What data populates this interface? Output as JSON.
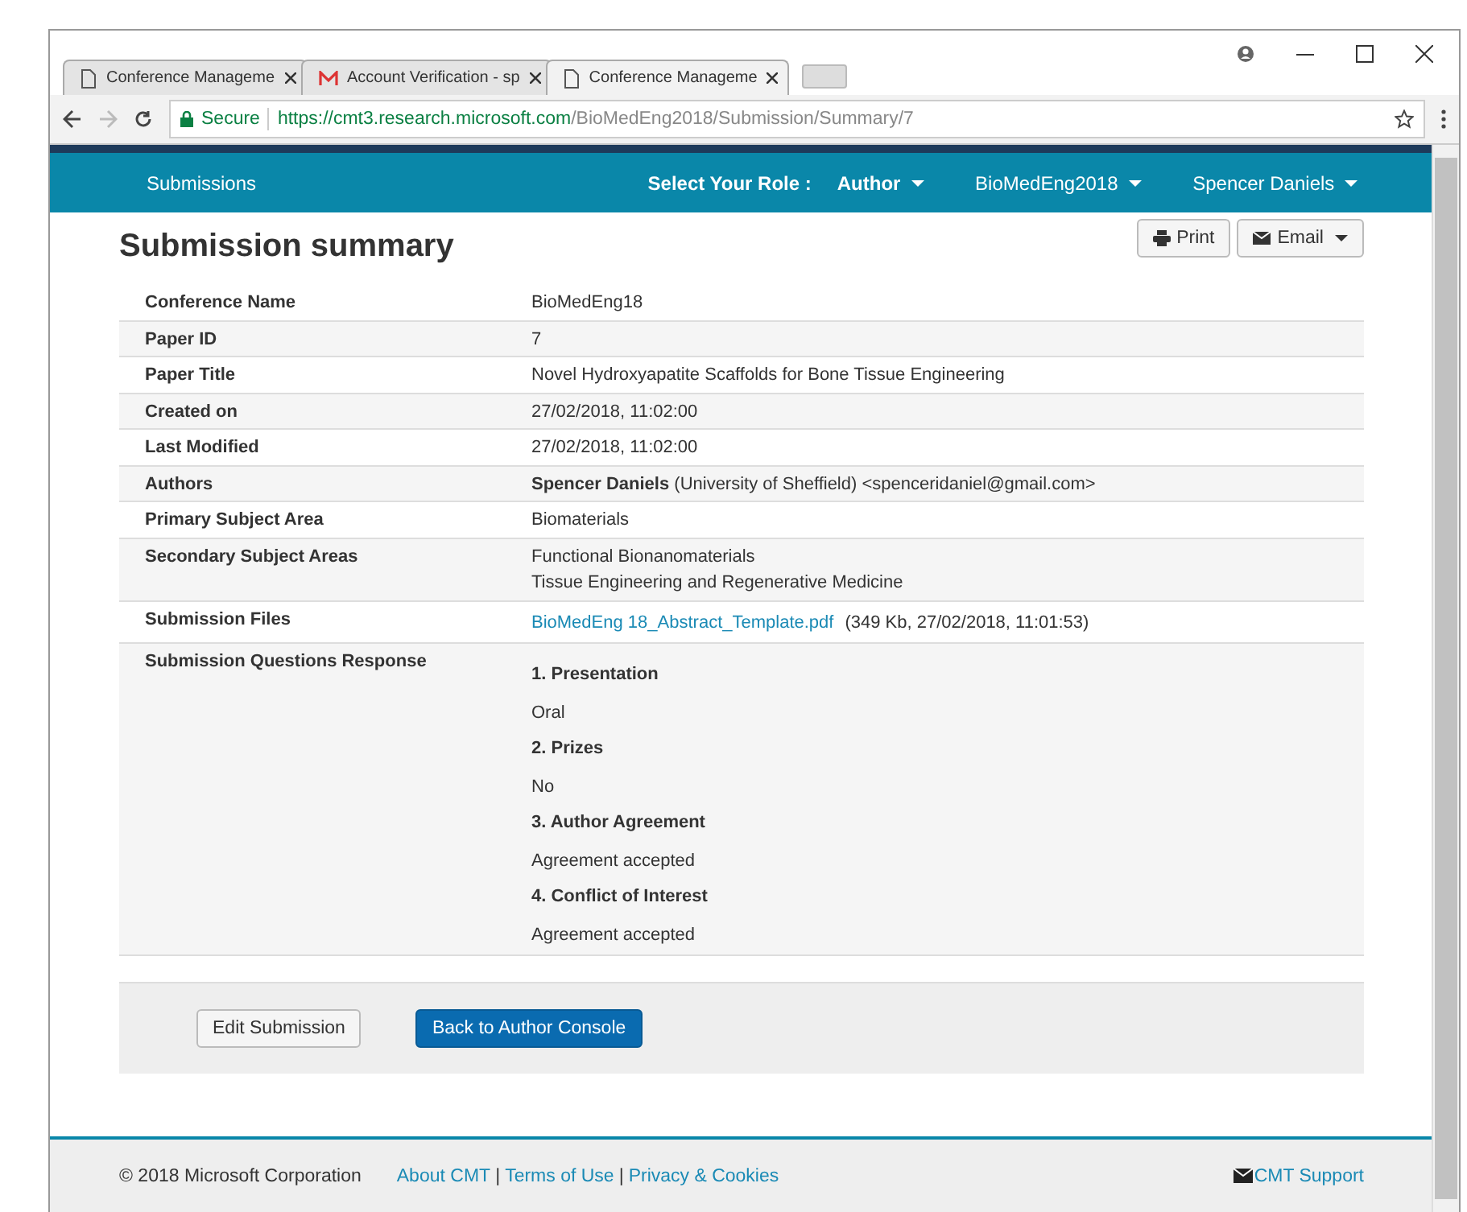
{
  "browser": {
    "tabs": [
      {
        "title": "Conference Manageme",
        "kind": "page",
        "selected": false
      },
      {
        "title": "Account Verification - sp",
        "kind": "mail",
        "selected": false
      },
      {
        "title": "Conference Manageme",
        "kind": "page",
        "selected": true
      }
    ],
    "secure_label": "Secure",
    "url_host": "https://cmt3.research.microsoft.com",
    "url_path": "/BioMedEng2018/Submission/Summary/7"
  },
  "navbar": {
    "left": "Submissions",
    "role_label": "Select Your Role :",
    "menus": [
      {
        "label": "Author",
        "bold": true
      },
      {
        "label": "BioMedEng2018",
        "bold": false
      },
      {
        "label": "Spencer Daniels",
        "bold": false
      }
    ]
  },
  "title": "Submission summary",
  "actions": [
    "Print",
    "Email"
  ],
  "rows": [
    {
      "label": "Conference Name",
      "kind": "text",
      "values": [
        "BioMedEng18"
      ]
    },
    {
      "label": "Paper ID",
      "kind": "text",
      "values": [
        "7"
      ]
    },
    {
      "label": "Paper Title",
      "kind": "text",
      "values": [
        "Novel Hydroxyapatite Scaffolds for Bone Tissue Engineering"
      ]
    },
    {
      "label": "Created on",
      "kind": "text",
      "values": [
        "27/02/2018, 11:02:00"
      ]
    },
    {
      "label": "Last Modified",
      "kind": "text",
      "values": [
        "27/02/2018, 11:02:00"
      ]
    },
    {
      "label": "Authors",
      "kind": "text",
      "values": [
        "**Spencer Daniels** (University of Sheffield) <spenceridaniel@gmail.com>"
      ]
    },
    {
      "label": "Primary Subject Area",
      "kind": "text",
      "values": [
        "Biomaterials"
      ]
    },
    {
      "label": "Secondary Subject Areas",
      "kind": "text",
      "values": [
        "Functional Bionanomaterials",
        "Tissue Engineering and Regenerative Medicine"
      ]
    },
    {
      "label": "Submission Files",
      "kind": "file",
      "link": "BioMedEng 18_Abstract_Template.pdf",
      "values": [
        "(349 Kb, 27/02/2018, 11:01:53)"
      ]
    },
    {
      "label": "Submission Questions Response",
      "kind": "questions",
      "questions": [
        {
          "q": "1. Presentation",
          "a": "Oral"
        },
        {
          "q": "2. Prizes",
          "a": "No"
        },
        {
          "q": "3. Author Agreement",
          "a": "Agreement accepted"
        },
        {
          "q": "4. Conflict of Interest",
          "a": "Agreement accepted"
        }
      ]
    }
  ],
  "buttons": [
    {
      "label": "Edit Submission",
      "primary": false
    },
    {
      "label": "Back to Author Console",
      "primary": true
    }
  ],
  "footer": {
    "copyright": "© 2018 Microsoft Corporation",
    "links": [
      "About CMT",
      "Terms of Use",
      "Privacy & Cookies"
    ],
    "separator": "|",
    "support": "CMT Support"
  }
}
